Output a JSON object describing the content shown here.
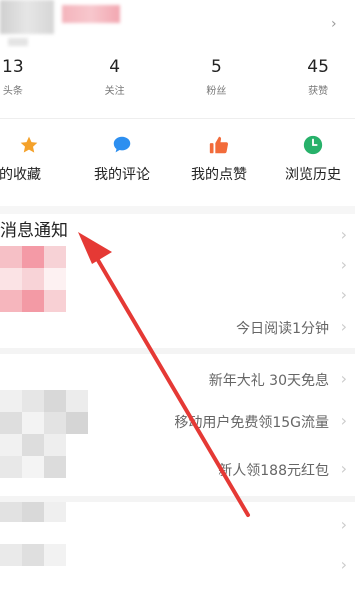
{
  "stats": [
    {
      "value": "13",
      "label": "头条"
    },
    {
      "value": "4",
      "label": "关注"
    },
    {
      "value": "5",
      "label": "粉丝"
    },
    {
      "value": "45",
      "label": "获赞"
    }
  ],
  "actions": [
    {
      "label": "的收藏",
      "icon": "star-icon",
      "color": "#f4a12a"
    },
    {
      "label": "我的评论",
      "icon": "comment-icon",
      "color": "#2d8ff0"
    },
    {
      "label": "我的点赞",
      "icon": "thumbs-up-icon",
      "color": "#f26b3a"
    },
    {
      "label": "浏览历史",
      "icon": "history-clock-icon",
      "color": "#27b16a"
    }
  ],
  "message_title": "消息通知",
  "list": [
    {
      "label": ""
    },
    {
      "label": ""
    },
    {
      "label": "今日阅读1分钟"
    },
    {
      "label": "新年大礼 30天免息"
    },
    {
      "label": "移动用户免费领15G流量"
    },
    {
      "label": "新人领188元红包"
    },
    {
      "label": ""
    },
    {
      "label": ""
    }
  ],
  "annotation": {
    "arrow_color": "#e53935"
  }
}
